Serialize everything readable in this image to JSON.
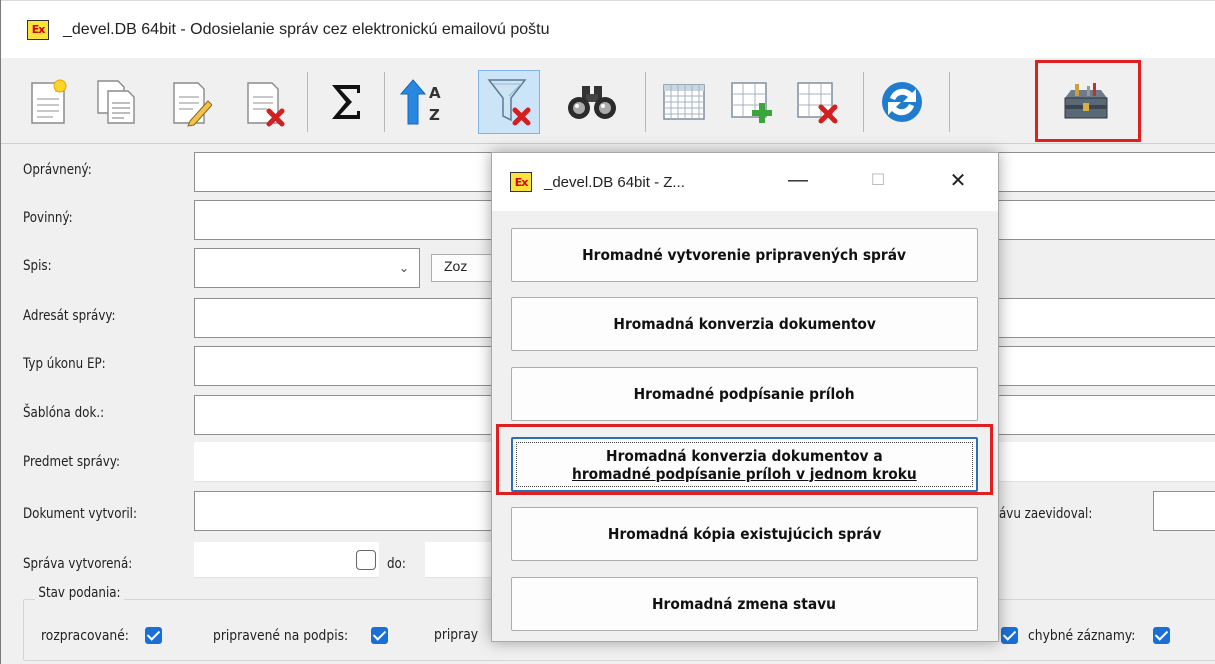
{
  "window": {
    "app_icon_text": "Ex",
    "title": "_devel.DB 64bit -  Odosielanie správ cez elektronickú emailovú poštu"
  },
  "toolbar": {
    "buttons": [
      {
        "icon": "new-document-icon"
      },
      {
        "icon": "copy-document-icon"
      },
      {
        "icon": "edit-document-icon"
      },
      {
        "icon": "delete-document-icon"
      },
      {
        "icon": "sum-icon"
      },
      {
        "icon": "sort-az-icon"
      },
      {
        "icon": "clear-filter-icon"
      },
      {
        "icon": "binoculars-icon"
      },
      {
        "icon": "grid-icon"
      },
      {
        "icon": "add-row-icon"
      },
      {
        "icon": "delete-row-icon"
      },
      {
        "icon": "refresh-icon"
      },
      {
        "icon": "toolbox-icon"
      }
    ]
  },
  "form": {
    "opravneny_label": "Oprávnený:",
    "povinny_label": "Povinný:",
    "spis_label": "Spis:",
    "spis_button": "Zoz",
    "adresat_label": "Adresát správy:",
    "typ_label": "Typ úkonu EP:",
    "sablona_label": "Šablóna dok.:",
    "predmet_label": "Predmet správy:",
    "dokument_label": "Dokument vytvoril:",
    "zaevidoval_label": "ávu zaevidoval:",
    "vytvorena_label": "Správa vytvorená:",
    "do_label": "do:",
    "stav_label": "Stav podania:",
    "stav_items": [
      {
        "label": "rozpracované:"
      },
      {
        "label": "pripravené na podpis:"
      },
      {
        "label": "pripray"
      },
      {
        "label": "chybné záznamy:"
      }
    ]
  },
  "dialog": {
    "app_icon_text": "Ex",
    "title": "_devel.DB 64bit - Z...",
    "minimize": "—",
    "maximize": "☐",
    "close": "✕",
    "buttons": [
      {
        "line1": "Hromadné vytvorenie pripravených správ",
        "line2": ""
      },
      {
        "line1": "Hromadná konverzia dokumentov",
        "line2": ""
      },
      {
        "line1": "Hromadné podpísanie príloh",
        "line2": ""
      },
      {
        "line1": "Hromadná konverzia dokumentov a",
        "line2": "hromadné podpísanie príloh v jednom kroku"
      },
      {
        "line1": "Hromadná kópia existujúcich správ",
        "line2": ""
      },
      {
        "line1": "Hromadná zmena stavu",
        "line2": ""
      }
    ]
  }
}
